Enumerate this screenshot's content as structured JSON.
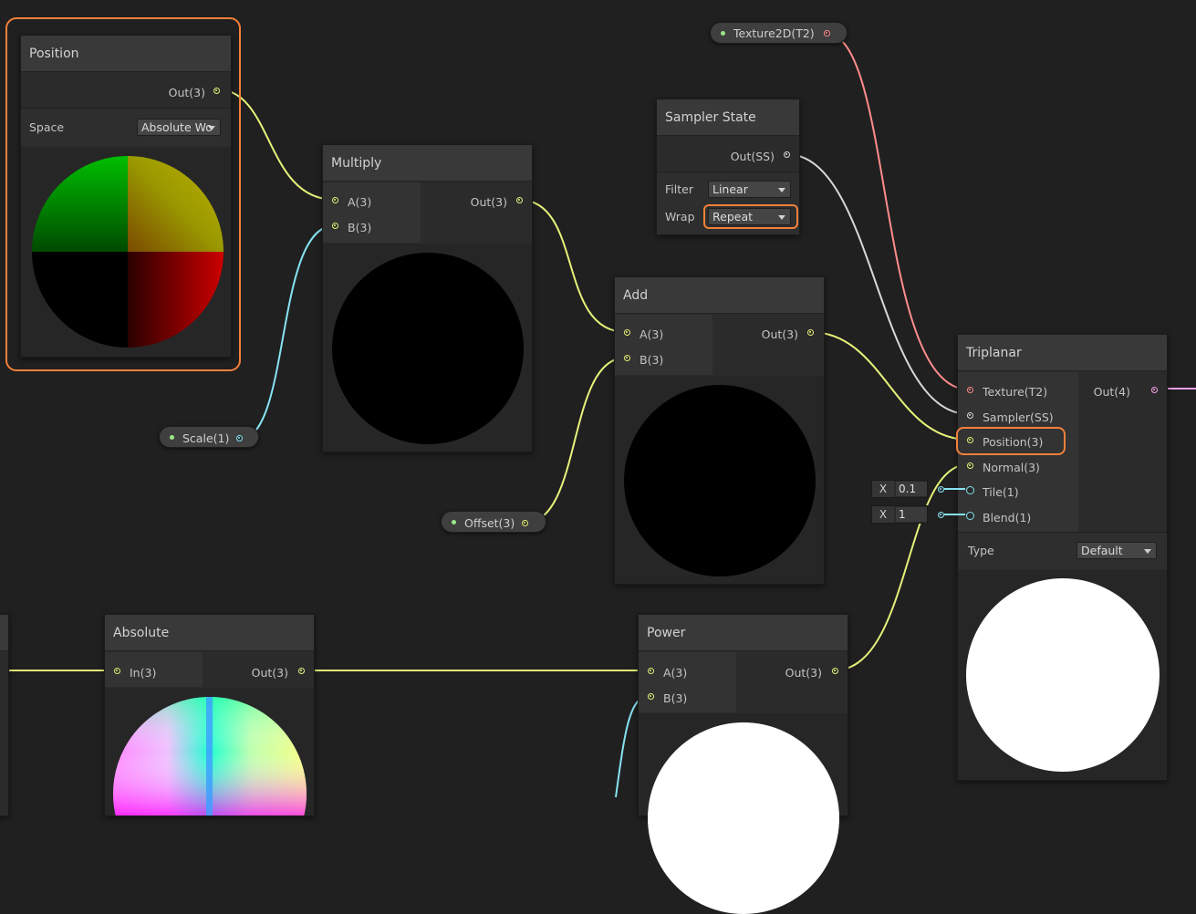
{
  "nodes": {
    "position": {
      "title": "Position",
      "out": "Out(3)",
      "space_label": "Space",
      "space_value": "Absolute Wo"
    },
    "multiply": {
      "title": "Multiply",
      "in_a": "A(3)",
      "in_b": "B(3)",
      "out": "Out(3)"
    },
    "sampler": {
      "title": "Sampler State",
      "out": "Out(SS)",
      "filter_label": "Filter",
      "filter_value": "Linear",
      "wrap_label": "Wrap",
      "wrap_value": "Repeat"
    },
    "add": {
      "title": "Add",
      "in_a": "A(3)",
      "in_b": "B(3)",
      "out": "Out(3)"
    },
    "triplanar": {
      "title": "Triplanar",
      "in_texture": "Texture(T2)",
      "in_sampler": "Sampler(SS)",
      "in_position": "Position(3)",
      "in_normal": "Normal(3)",
      "in_tile": "Tile(1)",
      "in_blend": "Blend(1)",
      "out": "Out(4)",
      "type_label": "Type",
      "type_value": "Default",
      "tile_axis": "X",
      "tile_value": "0.1",
      "blend_axis": "X",
      "blend_value": "1"
    },
    "absolute": {
      "title": "Absolute",
      "in": "In(3)",
      "out": "Out(3)"
    },
    "power": {
      "title": "Power",
      "in_a": "A(3)",
      "in_b": "B(3)",
      "out": "Out(3)"
    }
  },
  "properties": {
    "texture": "Texture2D(T2)",
    "scale": "Scale(1)",
    "offset": "Offset(3)"
  },
  "colors": {
    "vector3_wire": "#e6f27a",
    "vector1_wire": "#86e3f2",
    "texture_wire": "#ff8c8c",
    "sampler_wire": "#d8d8d8",
    "vector4_wire": "#f0a0e8",
    "highlight": "#f2803a"
  }
}
